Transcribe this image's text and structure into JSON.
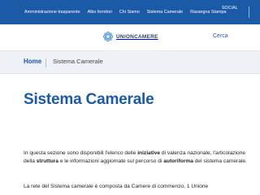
{
  "topbar": {
    "nav": [
      "Amministrazione trasparente",
      "Albo fornitori",
      "Chi Siamo",
      "Sistema Camerale",
      "Rassegna Stampa"
    ],
    "social_label": "SOCIAL",
    "color": "#1b5aa7"
  },
  "header": {
    "logo_text": "UNIONCAMERE",
    "search_label": "Cerca"
  },
  "breadcrumb": {
    "home": "Home",
    "current": "Sistema Camerale"
  },
  "page": {
    "title": "Sistema Camerale",
    "para1": {
      "t1": "In questa sezione sono disponibili l'elenco delle ",
      "b1": "iniziative",
      "t2": " di valenza nazionale, l'articolazione della ",
      "b2": "struttura",
      "t3": " e le informazioni aggiornate sul percorso di ",
      "b3": "autoriforma",
      "t4": " del sistema camerale."
    },
    "para2": "La rete del Sistema camerale è composta da Camere di commercio, 1 Unione"
  }
}
